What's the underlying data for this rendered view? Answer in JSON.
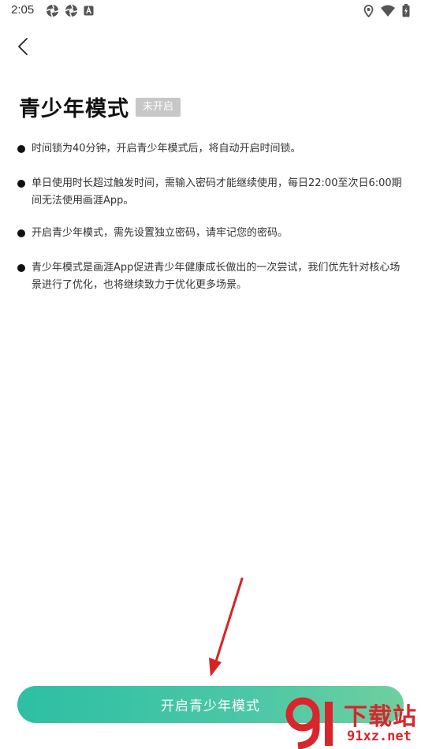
{
  "status_bar": {
    "time": "2:05",
    "left_icons": [
      "aperture-icon",
      "aperture-icon",
      "a-letter-icon"
    ],
    "right_icons": [
      "location-pin-icon",
      "wifi-icon",
      "battery-charging-icon"
    ]
  },
  "nav": {
    "back_icon": "back-arrow-icon"
  },
  "header": {
    "title": "青少年模式",
    "badge": "未开启"
  },
  "rules": [
    "时间锁为40分钟，开启青少年模式后，将自动开启时间锁。",
    "单日使用时长超过触发时间，需输入密码才能继续使用，每日22:00至次日6:00期间无法使用画涯App。",
    "开启青少年模式，需先设置独立密码，请牢记您的密码。",
    "青少年模式是画涯App促进青少年健康成长做出的一次尝试，我们优先针对核心场景进行了优化，也将继续致力于优化更多场景。"
  ],
  "primary_action": {
    "label": "开启青少年模式"
  },
  "watermark": {
    "main": "下载站",
    "sub": "91xz.net"
  },
  "colors": {
    "button_gradient_start": "#2dbfa4",
    "button_gradient_end": "#6fcf9f",
    "badge_bg": "#c7c7c7",
    "annotation_arrow": "#d92323",
    "watermark_red": "#d8262c"
  }
}
